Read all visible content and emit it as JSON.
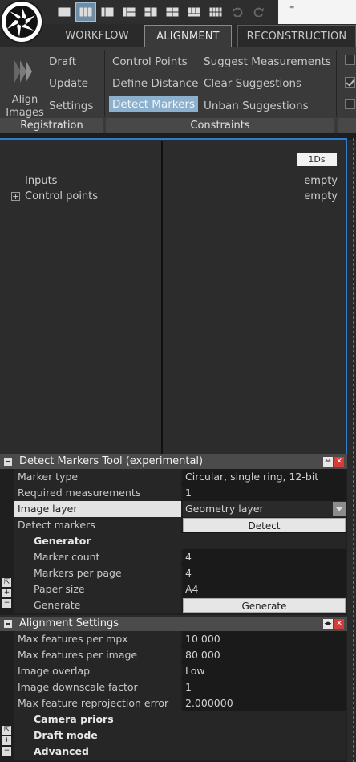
{
  "window": {
    "qat_dropdown": "⁼"
  },
  "tabs": [
    {
      "label": "WORKFLOW"
    },
    {
      "label": "ALIGNMENT"
    },
    {
      "label": "RECONSTRUCTION"
    }
  ],
  "ribbon": {
    "registration": {
      "align_images": "Align Images",
      "draft": "Draft",
      "update": "Update",
      "settings": "Settings",
      "group_label": "Registration"
    },
    "constraints": {
      "control_points": "Control Points",
      "define_distance": "Define Distance",
      "detect_markers": "Detect Markers",
      "suggest_measurements": "Suggest Measurements",
      "clear_suggestions": "Clear Suggestions",
      "unban_suggestions": "Unban Suggestions",
      "group_label": "Constraints"
    }
  },
  "main": {
    "badge": "1Ds",
    "tree": [
      {
        "label": "Inputs",
        "value": "empty"
      },
      {
        "label": "Control points",
        "value": "empty"
      }
    ]
  },
  "detect_panel": {
    "title": "Detect Markers Tool (experimental)",
    "rows": {
      "marker_type": {
        "key": "Marker type",
        "value": "Circular, single ring, 12-bit"
      },
      "required": {
        "key": "Required measurements",
        "value": "1"
      },
      "image_layer": {
        "key": "Image layer",
        "value": "Geometry layer"
      },
      "detect": {
        "key": "Detect markers",
        "button": "Detect"
      }
    },
    "generator": {
      "label": "Generator",
      "marker_count": {
        "key": "Marker count",
        "value": "4"
      },
      "markers_per_page": {
        "key": "Markers per page",
        "value": "4"
      },
      "paper_size": {
        "key": "Paper size",
        "value": "A4"
      },
      "generate": {
        "key": "Generate",
        "button": "Generate"
      }
    }
  },
  "alignment_panel": {
    "title": "Alignment Settings",
    "rows": [
      {
        "key": "Max features per mpx",
        "value": "10 000"
      },
      {
        "key": "Max features per image",
        "value": "80 000"
      },
      {
        "key": "Image overlap",
        "value": "Low"
      },
      {
        "key": "Image downscale factor",
        "value": "1"
      },
      {
        "key": "Max feature reprojection error",
        "value": "2.000000"
      }
    ],
    "groups": [
      {
        "label": "Camera priors"
      },
      {
        "label": "Draft mode"
      },
      {
        "label": "Advanced"
      }
    ]
  }
}
